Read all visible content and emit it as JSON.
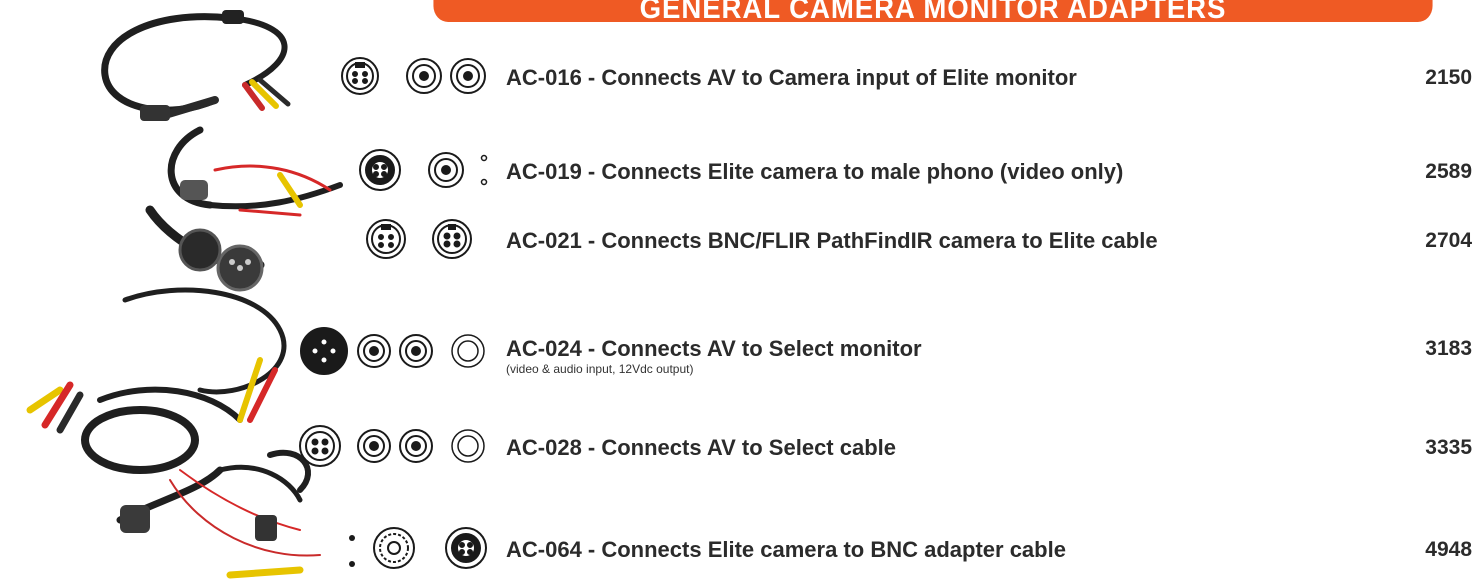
{
  "banner": {
    "title": "GENERAL CAMERA MONITOR ADAPTERS"
  },
  "colors": {
    "banner": "#ef5a24",
    "text": "#2b2b2b",
    "icon_stroke": "#1a1a1a"
  },
  "products": [
    {
      "title": "AC-016 - Connects AV to Camera input of Elite monitor",
      "subtitle": "",
      "price": "2150",
      "icons": [
        "minidin-4pin-icon",
        "rca-jack-icon",
        "rca-jack-icon"
      ]
    },
    {
      "title": "AC-019 - Connects Elite camera to male phono (video only)",
      "subtitle": "",
      "price": "2589",
      "icons": [
        "aviation-4pin-icon",
        "rca-jack-icon",
        "power-dots-icon"
      ]
    },
    {
      "title": "AC-021 - Connects BNC/FLIR PathFindIR camera to Elite cable",
      "subtitle": "",
      "price": "2704",
      "icons": [
        "minidin-4pin-icon",
        "pin-4-socket-icon"
      ]
    },
    {
      "title": "AC-024 - Connects AV to Select monitor",
      "subtitle": "(video & audio input, 12Vdc output)",
      "price": "3183",
      "icons": [
        "solid-4pin-connector-icon",
        "rca-jack-icon",
        "rca-jack-icon",
        "dc-plug-icon"
      ]
    },
    {
      "title": "AC-028 - Connects AV to Select cable",
      "subtitle": "",
      "price": "3335",
      "icons": [
        "pin-4-socket-icon",
        "rca-jack-icon",
        "rca-jack-icon",
        "dc-plug-icon"
      ]
    },
    {
      "title": "AC-064 - Connects Elite camera to BNC adapter cable",
      "subtitle": "",
      "price": "4948",
      "icons": [
        "power-dots-icon",
        "bnc-connector-icon",
        "aviation-4pin-icon"
      ]
    }
  ]
}
